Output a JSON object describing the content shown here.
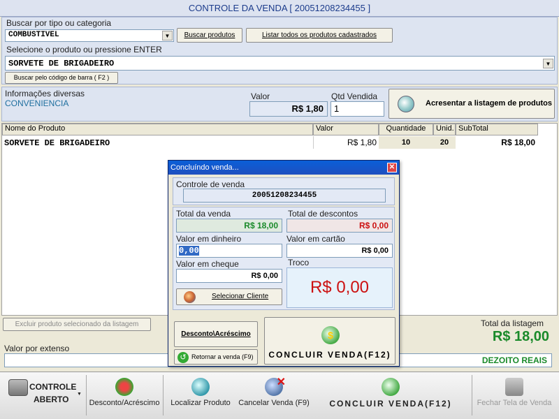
{
  "window": {
    "title": "CONTROLE DA VENDA  [ 20051208234455 ]"
  },
  "search": {
    "type_label": "Buscar por tipo ou categoria",
    "category_value": "COMBUSTIVEL",
    "search_products_btn": "Buscar produtos",
    "list_all_btn": "Listar todos os produtos cadastrados",
    "select_label": "Selecione o produto ou pressione ENTER",
    "product_value": "SORVETE DE BRIGADEIRO",
    "barcode_btn": "Buscar pelo código de barra ( F2 )"
  },
  "info": {
    "misc_label": "Informações diversas",
    "misc_value": "CONVENIENCIA",
    "price_label": "Valor",
    "price_value": "R$ 1,80",
    "qty_label": "Qtd Vendida",
    "qty_value": "1",
    "add_btn": "Acresentar a listagem de produtos"
  },
  "grid": {
    "columns": [
      "Nome do Produto",
      "Valor",
      "Quantidade",
      "Unid.",
      "SubTotal"
    ],
    "rows": [
      {
        "name": "SORVETE DE BRIGADEIRO",
        "valor": "R$ 1,80",
        "qtd": "10",
        "unid": "20",
        "subtotal": "R$ 18,00"
      }
    ]
  },
  "bottom": {
    "remove_btn": "Excluir produto selecionado da listagem",
    "total_label": "Total da listagem",
    "total_value": "R$ 18,00",
    "extenso_label": "Valor por extenso",
    "extenso_value": "DEZOITO REAIS"
  },
  "dialog": {
    "title": "Concluíndo venda...",
    "control_label": "Controle de venda",
    "control_value": "20051208234455",
    "total_venda_label": "Total da venda",
    "total_venda_value": "R$ 18,00",
    "total_desc_label": "Total de descontos",
    "total_desc_value": "R$ 0,00",
    "dinheiro_label": "Valor em dinheiro",
    "dinheiro_value": "0,00",
    "cartao_label": "Valor em cartão",
    "cartao_value": "R$ 0,00",
    "cheque_label": "Valor em cheque",
    "cheque_value": "R$ 0,00",
    "troco_label": "Troco",
    "troco_value": "R$ 0,00",
    "select_client_btn": "Selecionar Cliente",
    "desconto_btn": "Desconto\\Acréscimo",
    "retornar_btn": "Retornar a venda (F9)",
    "concluir_btn": "CONCLUIR VENDA(F12)"
  },
  "toolbar": {
    "controle_line1": "CONTROLE",
    "controle_line2": "ABERTO",
    "desconto": "Desconto/Acréscimo",
    "localizar": "Localizar Produto",
    "cancelar": "Cancelar Venda (F9)",
    "concluir": "CONCLUIR VENDA(F12)",
    "fechar": "Fechar Tela de Venda"
  },
  "colors": {
    "accent_blue": "#1c3c8c",
    "money_green": "#1a8a2a",
    "money_red": "#cc1111",
    "info_teal": "#1f6f9f"
  }
}
